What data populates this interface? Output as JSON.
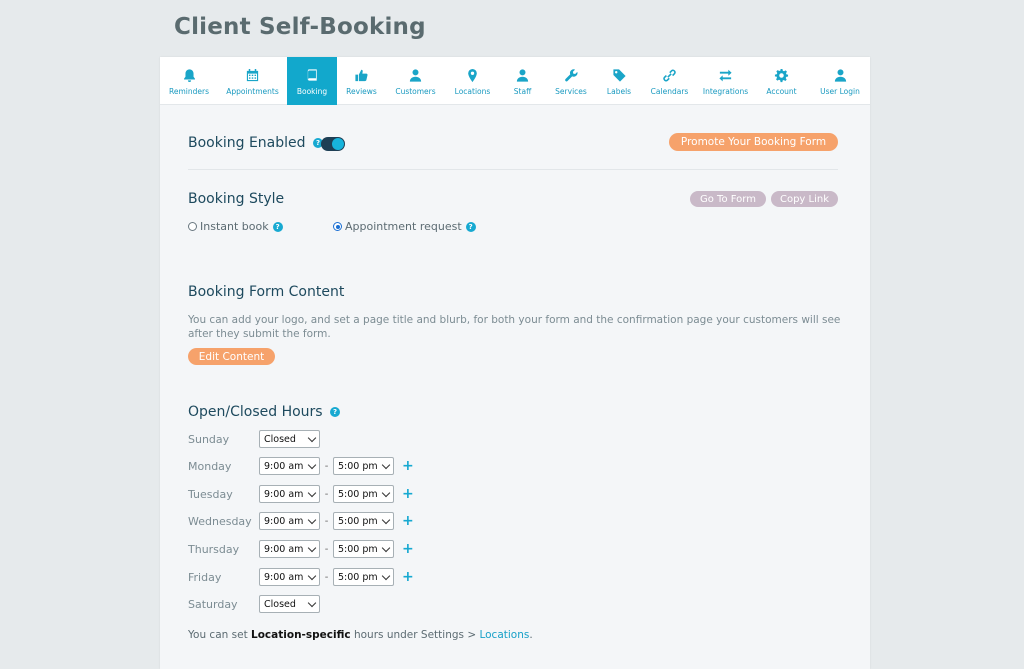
{
  "page_title": "Client Self-Booking",
  "tabs": [
    {
      "label": "Reminders",
      "icon": "bell-icon",
      "active": false
    },
    {
      "label": "Appointments",
      "icon": "calendar-icon",
      "active": false
    },
    {
      "label": "Booking",
      "icon": "book-icon",
      "active": true
    },
    {
      "label": "Reviews",
      "icon": "thumbs-up-icon",
      "active": false
    },
    {
      "label": "Customers",
      "icon": "user-icon",
      "active": false
    },
    {
      "label": "Locations",
      "icon": "map-pin-icon",
      "active": false
    },
    {
      "label": "Staff",
      "icon": "user-icon",
      "active": false
    },
    {
      "label": "Services",
      "icon": "wrench-icon",
      "active": false
    },
    {
      "label": "Labels",
      "icon": "tag-icon",
      "active": false
    },
    {
      "label": "Calendars",
      "icon": "link-icon",
      "active": false
    },
    {
      "label": "Integrations",
      "icon": "exchange-icon",
      "active": false
    },
    {
      "label": "Account",
      "icon": "gear-icon",
      "active": false
    },
    {
      "label": "User Login",
      "icon": "user-icon",
      "active": false
    }
  ],
  "booking_enabled": {
    "label": "Booking Enabled",
    "enabled": true
  },
  "promote_button": "Promote Your Booking Form",
  "booking_style": {
    "heading": "Booking Style",
    "go_to_form": "Go To Form",
    "copy_link": "Copy Link",
    "options": [
      {
        "label": "Instant book",
        "checked": false
      },
      {
        "label": "Appointment request",
        "checked": true
      }
    ]
  },
  "form_content": {
    "heading": "Booking Form Content",
    "description": "You can add your logo, and set a page title and blurb, for both your form and the confirmation page your customers will see after they submit the form.",
    "edit_button": "Edit Content"
  },
  "hours": {
    "heading": "Open/Closed Hours",
    "separator": "-",
    "add_symbol": "+",
    "days": [
      {
        "day": "Sunday",
        "closed": true,
        "status": "Closed"
      },
      {
        "day": "Monday",
        "closed": false,
        "open": "9:00 am",
        "close": "5:00 pm"
      },
      {
        "day": "Tuesday",
        "closed": false,
        "open": "9:00 am",
        "close": "5:00 pm"
      },
      {
        "day": "Wednesday",
        "closed": false,
        "open": "9:00 am",
        "close": "5:00 pm"
      },
      {
        "day": "Thursday",
        "closed": false,
        "open": "9:00 am",
        "close": "5:00 pm"
      },
      {
        "day": "Friday",
        "closed": false,
        "open": "9:00 am",
        "close": "5:00 pm"
      },
      {
        "day": "Saturday",
        "closed": true,
        "status": "Closed"
      }
    ]
  },
  "footer": {
    "prefix": "You can set ",
    "bold": "Location-specific",
    "middle": " hours under Settings > ",
    "link": "Locations",
    "suffix": "."
  },
  "colors": {
    "accent": "#12a8cc",
    "orange": "#f6a26b",
    "mauve": "#c9b9c8",
    "toggle_track": "#1e3f55"
  }
}
